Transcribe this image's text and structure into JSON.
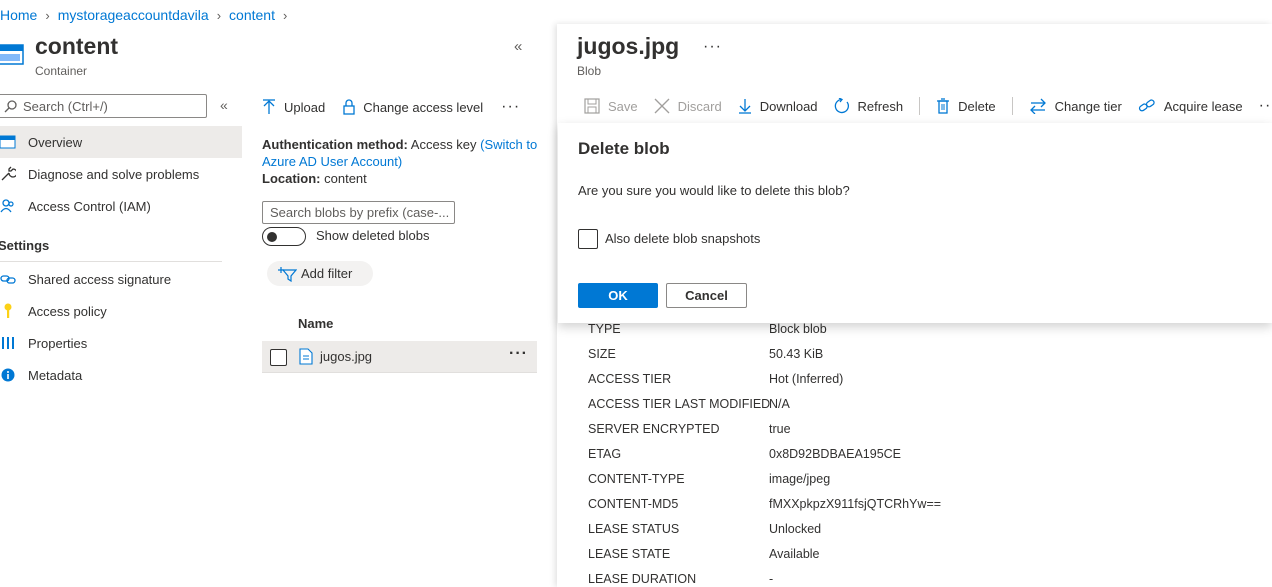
{
  "breadcrumb": {
    "items": [
      "Home",
      "mystorageaccountdavila",
      "content"
    ]
  },
  "left_blade": {
    "title": "content",
    "subtitle": "Container",
    "search_placeholder": "Search (Ctrl+/)",
    "nav": [
      {
        "label": "Overview",
        "icon": "overview-icon",
        "selected": true
      },
      {
        "label": "Diagnose and solve problems",
        "icon": "wrench-icon"
      },
      {
        "label": "Access Control (IAM)",
        "icon": "people-icon"
      }
    ],
    "settings_header": "Settings",
    "settings_nav": [
      {
        "label": "Shared access signature",
        "icon": "link-icon"
      },
      {
        "label": "Access policy",
        "icon": "key-icon"
      },
      {
        "label": "Properties",
        "icon": "properties-icon"
      },
      {
        "label": "Metadata",
        "icon": "info-icon"
      }
    ]
  },
  "middle": {
    "toolbar": {
      "upload": "Upload",
      "change_access": "Change access level",
      "more": "···"
    },
    "auth_label": "Authentication method:",
    "auth_value": "Access key",
    "auth_link": "(Switch to Azure AD User Account)",
    "location_label": "Location:",
    "location_value": "content",
    "blob_search_placeholder": "Search blobs by prefix (case-...",
    "show_deleted": "Show deleted blobs",
    "add_filter": "Add filter",
    "column_name": "Name",
    "blobs": [
      {
        "name": "jugos.jpg"
      }
    ],
    "row_more": "···"
  },
  "right_blade": {
    "title": "jugos.jpg",
    "more": "···",
    "subtitle": "Blob",
    "toolbar": {
      "save": "Save",
      "discard": "Discard",
      "download": "Download",
      "refresh": "Refresh",
      "delete": "Delete",
      "change_tier": "Change tier",
      "acquire_lease": "Acquire lease",
      "more": "···"
    },
    "properties": [
      {
        "key": "TYPE",
        "value": "Block blob"
      },
      {
        "key": "SIZE",
        "value": "50.43 KiB"
      },
      {
        "key": "ACCESS TIER",
        "value": "Hot (Inferred)"
      },
      {
        "key": "ACCESS TIER LAST MODIFIED",
        "value": "N/A"
      },
      {
        "key": "SERVER ENCRYPTED",
        "value": "true"
      },
      {
        "key": "ETAG",
        "value": "0x8D92BDBAEA195CE"
      },
      {
        "key": "CONTENT-TYPE",
        "value": "image/jpeg"
      },
      {
        "key": "CONTENT-MD5",
        "value": "fMXXpkpzX911fsjQTCRhYw=="
      },
      {
        "key": "LEASE STATUS",
        "value": "Unlocked"
      },
      {
        "key": "LEASE STATE",
        "value": "Available"
      },
      {
        "key": "LEASE DURATION",
        "value": "-"
      }
    ]
  },
  "dialog": {
    "title": "Delete blob",
    "message": "Are you sure you would like to delete this blob?",
    "checkbox_label": "Also delete blob snapshots",
    "ok": "OK",
    "cancel": "Cancel"
  },
  "colors": {
    "accent": "#0078d4",
    "selected_bg": "#edebe9",
    "text": "#323130"
  }
}
